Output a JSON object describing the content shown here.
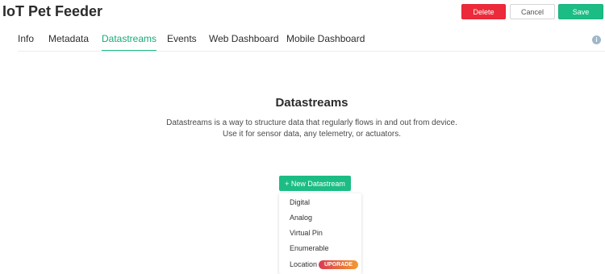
{
  "app": {
    "title": "IoT Pet Feeder"
  },
  "actions": {
    "delete_label": "Delete",
    "cancel_label": "Cancel",
    "save_label": "Save"
  },
  "tabs": [
    {
      "label": "Info",
      "active": false
    },
    {
      "label": "Metadata",
      "active": false
    },
    {
      "label": "Datastreams",
      "active": true
    },
    {
      "label": "Events",
      "active": false
    },
    {
      "label": "Web Dashboard",
      "active": false
    },
    {
      "label": "Mobile Dashboard",
      "active": false
    }
  ],
  "info_icon": {
    "glyph": "i"
  },
  "empty_state": {
    "title": "Datastreams",
    "description_line1": "Datastreams is a way to structure data that regularly flows in and out from device.",
    "description_line2": "Use it for sensor data, any telemetry, or actuators."
  },
  "new_datastream_label": "+ New Datastream",
  "menu": {
    "items": [
      {
        "label": "Digital"
      },
      {
        "label": "Analog"
      },
      {
        "label": "Virtual Pin"
      },
      {
        "label": "Enumerable"
      },
      {
        "label": "Location",
        "badge": "UPGRADE"
      }
    ]
  },
  "colors": {
    "accent": "#1cbd84",
    "danger": "#ec2b3a",
    "upgrade_start": "#d93a52",
    "upgrade_end": "#f39b2f"
  }
}
